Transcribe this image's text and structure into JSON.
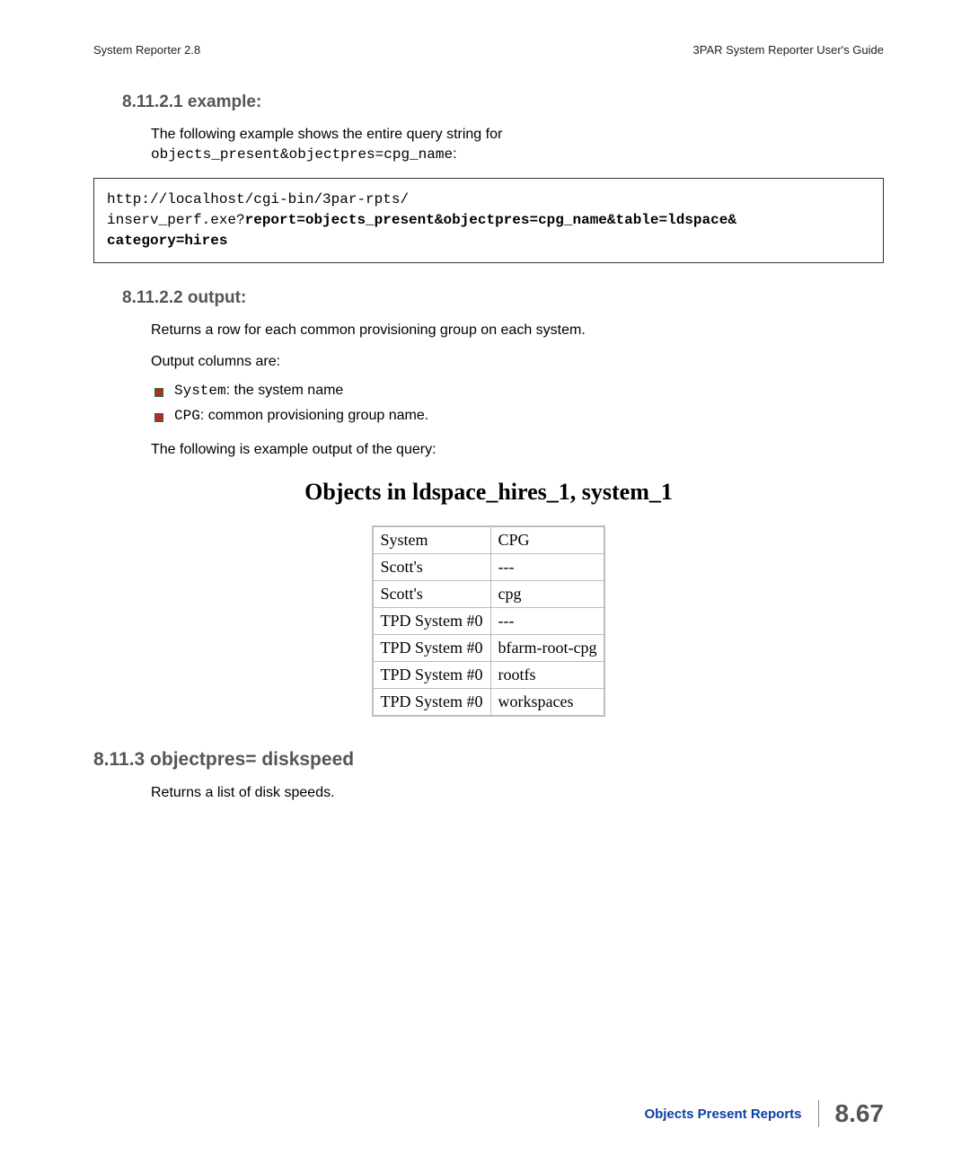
{
  "header": {
    "left": "System Reporter 2.8",
    "right": "3PAR System Reporter User's Guide"
  },
  "sections": {
    "example_heading": "8.11.2.1 example:",
    "example_intro": "The following example shows the entire query string for",
    "example_query": "objects_present&objectpres=cpg_name",
    "example_colon": ":",
    "code": {
      "line1": "http://localhost/cgi-bin/3par-rpts/",
      "line2a": "inserv_perf.exe?",
      "line2b": "report=objects_present&objectpres=cpg_name&table=ldspace&",
      "line3": "category=hires"
    },
    "output_heading": "8.11.2.2 output:",
    "output_p1": "Returns a row for each common provisioning group on each system.",
    "output_p2": "Output columns are:",
    "bullets": [
      {
        "code": "System",
        "text": ": the system name"
      },
      {
        "code": "CPG",
        "text": ": common provisioning group name."
      }
    ],
    "output_p3": "The following is example output of the query:",
    "table_title": "Objects in ldspace_hires_1, system_1",
    "table": {
      "headers": [
        "System",
        "CPG"
      ],
      "rows": [
        [
          "Scott's",
          "---"
        ],
        [
          "Scott's",
          "cpg"
        ],
        [
          "TPD System #0",
          "---"
        ],
        [
          "TPD System #0",
          "bfarm-root-cpg"
        ],
        [
          "TPD System #0",
          "rootfs"
        ],
        [
          "TPD System #0",
          "workspaces"
        ]
      ]
    },
    "diskspeed_heading": "8.11.3 objectpres= diskspeed",
    "diskspeed_p1": "Returns a list of disk speeds."
  },
  "footer": {
    "section": "Objects Present Reports",
    "page": "8.67"
  }
}
